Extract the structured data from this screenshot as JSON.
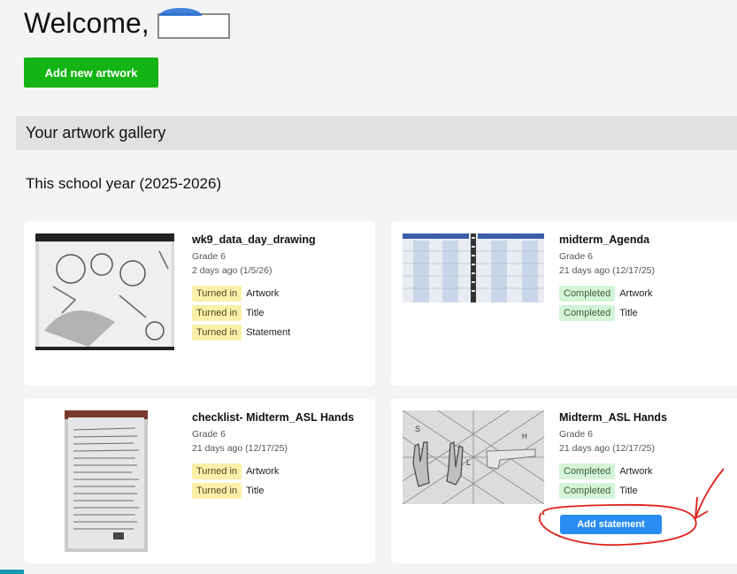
{
  "header": {
    "welcome_text": "Welcome,",
    "add_artwork_label": "Add new artwork"
  },
  "gallery": {
    "heading": "Your artwork gallery",
    "year_heading": "This school year (2025-2026)"
  },
  "colors": {
    "add_button": "#14b414",
    "turned_in_badge": "#fbf0a8",
    "completed_badge": "#d3f4d5",
    "add_statement_button": "#2a8df1",
    "annotation": "#e0201a"
  },
  "cards": [
    {
      "title": "wk9_data_day_drawing",
      "grade": "Grade 6",
      "date": "2 days ago (1/5/26)",
      "statuses": [
        {
          "badge": "Turned in",
          "label": "Artwork"
        },
        {
          "badge": "Turned in",
          "label": "Title"
        },
        {
          "badge": "Turned in",
          "label": "Statement"
        }
      ]
    },
    {
      "title": "midterm_Agenda",
      "grade": "Grade 6",
      "date": "21 days ago (12/17/25)",
      "statuses": [
        {
          "badge": "Completed",
          "label": "Artwork"
        },
        {
          "badge": "Completed",
          "label": "Title"
        }
      ]
    },
    {
      "title": "checklist- Midterm_ASL Hands",
      "grade": "Grade 6",
      "date": "21 days ago (12/17/25)",
      "statuses": [
        {
          "badge": "Turned in",
          "label": "Artwork"
        },
        {
          "badge": "Turned in",
          "label": "Title"
        }
      ]
    },
    {
      "title": "Midterm_ASL Hands",
      "grade": "Grade 6",
      "date": "21 days ago (12/17/25)",
      "statuses": [
        {
          "badge": "Completed",
          "label": "Artwork"
        },
        {
          "badge": "Completed",
          "label": "Title"
        }
      ],
      "action_label": "Add statement"
    }
  ]
}
